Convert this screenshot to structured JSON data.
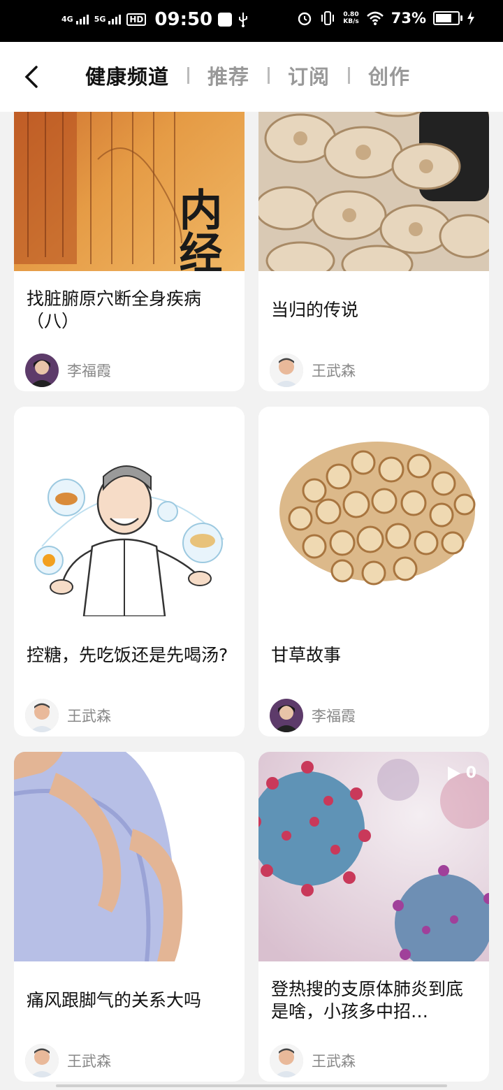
{
  "status_bar": {
    "net1": "4G",
    "net2": "5G",
    "hd": "HD",
    "time": "09:50",
    "speed_value": "0.80",
    "speed_unit": "KB/s",
    "battery": "73%",
    "battery_level": 0.73
  },
  "header": {
    "tabs": [
      {
        "label": "健康频道"
      },
      {
        "label": "推荐"
      },
      {
        "label": "订阅"
      },
      {
        "label": "创作"
      }
    ]
  },
  "cards": [
    {
      "title": "找脏腑原穴断全身疾病（八）",
      "author": "李福霞"
    },
    {
      "title": "当归的传说",
      "author": "王武森"
    },
    {
      "title": "控糖，先吃饭还是先喝汤?",
      "author": "王武森"
    },
    {
      "title": "甘草故事",
      "author": "李福霞"
    },
    {
      "title": "痛风跟脚气的关系大吗",
      "author": "王武森"
    },
    {
      "title": "登热搜的支原体肺炎到底是啥，小孩多中招…",
      "author": "王武森",
      "play_count": "0"
    }
  ],
  "book_cover_text": "内经"
}
